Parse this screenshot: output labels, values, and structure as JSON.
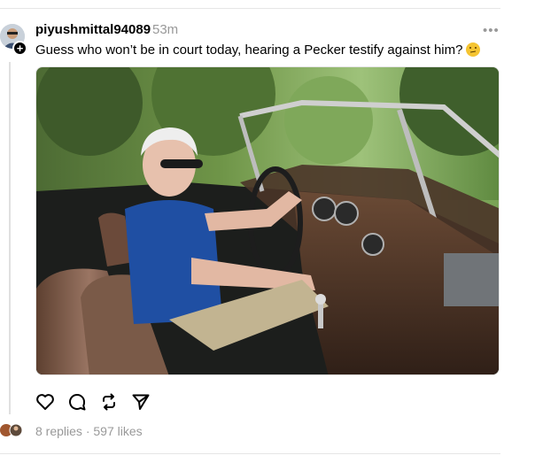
{
  "post": {
    "username": "piyushmittal94089",
    "timestamp": "53m",
    "caption": "Guess who won’t be in court today, hearing a Pecker testify against him?",
    "caption_emoji": "thinking-face-emoji",
    "photo_alt": "Man in blue polo shirt and sunglasses sitting in a vintage convertible",
    "replies_text": "8 replies",
    "separator": "·",
    "likes_text": "597 likes"
  },
  "icons": {
    "more": "more-dots-icon",
    "like": "heart-icon",
    "reply": "comment-bubble-icon",
    "repost": "repost-icon",
    "share": "send-icon",
    "follow": "plus-icon"
  },
  "colors": {
    "text": "#000000",
    "muted": "#999999",
    "divider": "#e6e6e6"
  }
}
